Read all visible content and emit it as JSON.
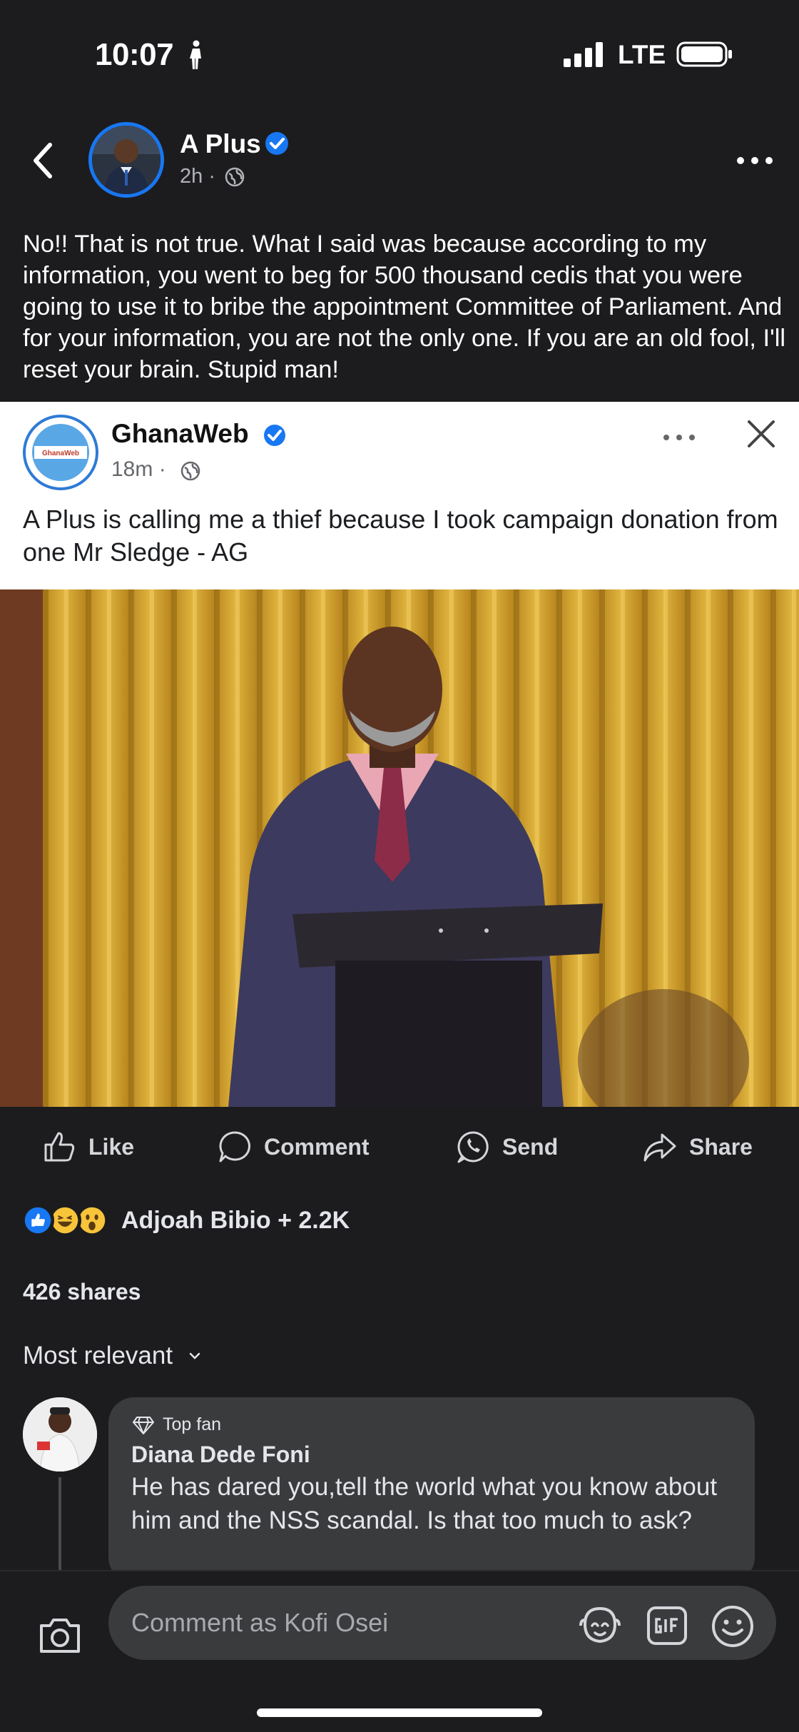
{
  "status_bar": {
    "time": "10:07",
    "network": "LTE"
  },
  "post": {
    "author": "A Plus",
    "time": "2h ·",
    "text": "No!! That is not true. What I said was because according to my information, you went to beg for 500 thousand cedis that you were going to use it to bribe the appointment Committee of Parliament. And for your information, you are not the only one. If you are an old fool, I'll reset your brain. Stupid man!"
  },
  "embedded": {
    "page_name": "GhanaWeb",
    "avatar_text": "GhanaWeb",
    "time": "18m ·",
    "text": "A Plus is calling me a thief because I took campaign donation from one Mr Sledge - AG"
  },
  "actions": {
    "like": "Like",
    "comment": "Comment",
    "send": "Send",
    "share": "Share"
  },
  "reactions": {
    "summary": "Adjoah Bibio + 2.2K",
    "types": [
      "like",
      "haha",
      "wow"
    ]
  },
  "shares": "426 shares",
  "sort_label": "Most relevant",
  "comments": [
    {
      "badge": "Top fan",
      "name": "Diana Dede Foni",
      "text": "He has dared you,tell the world what you know about him and the NSS scandal. Is that too much to ask?"
    }
  ],
  "composer": {
    "placeholder": "Comment as Kofi Osei"
  },
  "colors": {
    "background": "#1c1c1e",
    "accent": "#1877f2",
    "bubble": "#3a3b3c"
  }
}
